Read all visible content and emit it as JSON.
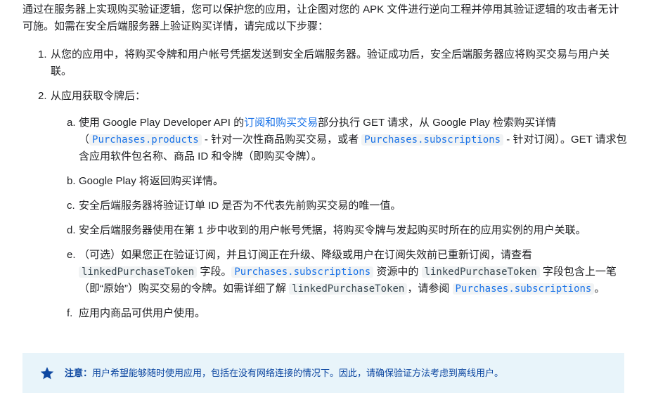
{
  "intro": "通过在服务器上实现购买验证逻辑，您可以保护您的应用，让企图对您的 APK 文件进行逆向工程并停用其验证逻辑的攻击者无计可施。如需在安全后端服务器上验证购买详情，请完成以下步骤：",
  "steps": [
    {
      "num": "1.",
      "text": "从您的应用中，将购买令牌和用户帐号凭据发送到安全后端服务器。验证成功后，安全后端服务器应将购买交易与用户关联。"
    },
    {
      "num": "2.",
      "text": "从应用获取令牌后："
    }
  ],
  "substeps": {
    "a": {
      "letter": "a.",
      "t1": "使用 Google Play Developer API 的",
      "link": "订阅和购买交易",
      "t2": "部分执行 GET 请求，从 Google Play 检索购买详情（",
      "code1": "Purchases.products",
      "t3": " - 针对一次性商品购买交易，或者 ",
      "code2": "Purchases.subscriptions",
      "t4": " - 针对订阅）。GET 请求包含应用软件包名称、商品 ID 和令牌（即购买令牌）。"
    },
    "b": {
      "letter": "b.",
      "text": "Google Play 将返回购买详情。"
    },
    "c": {
      "letter": "c.",
      "text": "安全后端服务器将验证订单 ID 是否为不代表先前购买交易的唯一值。"
    },
    "d": {
      "letter": "d.",
      "text": "安全后端服务器使用在第 1 步中收到的用户帐号凭据，将购买令牌与发起购买时所在的应用实例的用户关联。"
    },
    "e": {
      "letter": "e.",
      "t1": "（可选）如果您正在验证订阅，并且订阅正在升级、降级或用户在订阅失效前已重新订阅，请查看 ",
      "code1": "linkedPurchaseToken",
      "t2": " 字段。",
      "code2": "Purchases.subscriptions",
      "t3": " 资源中的 ",
      "code3": "linkedPurchaseToken",
      "t4": " 字段包含上一笔（即“原始”）购买交易的令牌。如需详细了解 ",
      "code4": "linkedPurchaseToken",
      "t5": "，请参阅 ",
      "code5": "Purchases.subscriptions",
      "t6": "。"
    },
    "f": {
      "letter": "f.",
      "text": "应用内商品可供用户使用。"
    }
  },
  "note": {
    "icon": "star-icon",
    "label": "注意：",
    "text": "用户希望能够随时使用应用，包括在没有网络连接的情况下。因此，请确保验证方法考虑到离线用户。",
    "background": "#e8f4fa",
    "color": "#0d47a1"
  }
}
